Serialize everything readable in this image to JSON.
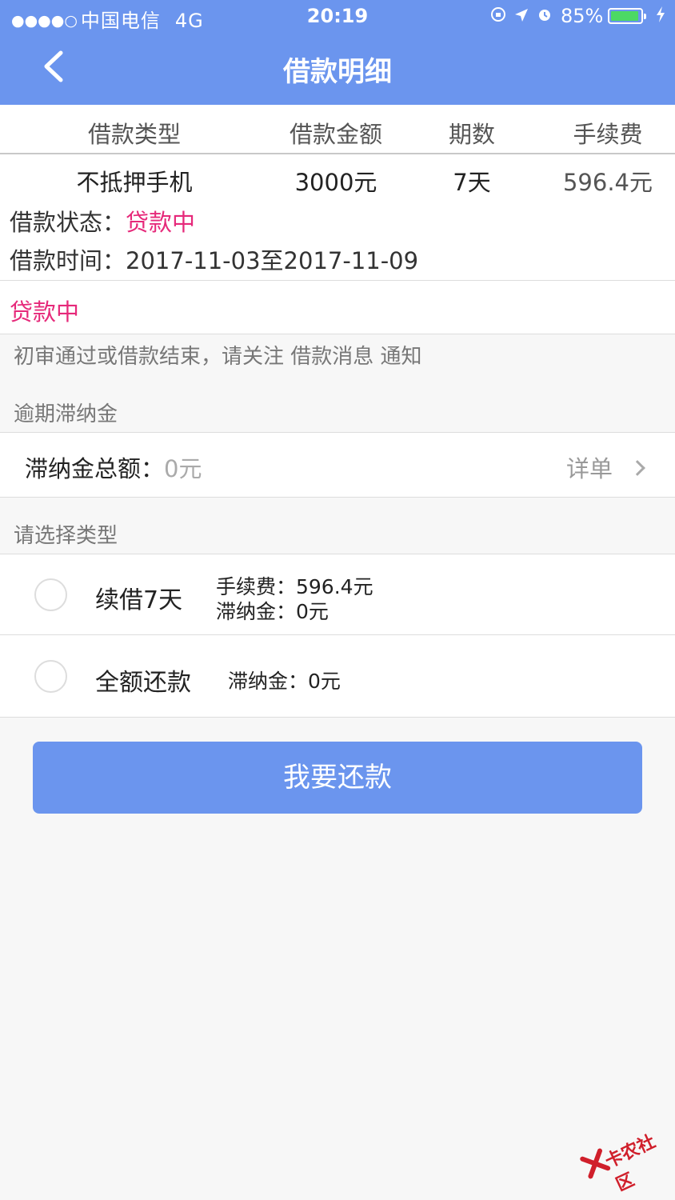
{
  "status_bar": {
    "signal": "●●●●○",
    "carrier": "中国电信",
    "network": "4G",
    "time": "20:19",
    "battery": "85%",
    "icons": [
      "orientation-lock-icon",
      "location-icon",
      "alarm-icon",
      "battery-icon",
      "charging-icon"
    ]
  },
  "nav": {
    "title": "借款明细",
    "back_icon": "back-chevron-icon",
    "bg_color": "#6b95ee"
  },
  "loan_table": {
    "headers": [
      "借款类型",
      "借款金额",
      "期数",
      "手续费"
    ],
    "row": [
      "不抵押手机",
      "3000元",
      "7天",
      "596.4元"
    ]
  },
  "loan_info": {
    "status_label": "借款状态：",
    "status_value": "贷款中",
    "time_label": "借款时间：",
    "time_value": "2017-11-03至2017-11-09"
  },
  "status_block": {
    "text": "贷款中",
    "color": "#e6297a"
  },
  "notice": "初审通过或借款结束，请关注 借款消息 通知",
  "late_fee": {
    "section_title": "逾期滞纳金",
    "label": "滞纳金总额：",
    "value": "0元",
    "detail_label": "详单"
  },
  "type_select": {
    "section_title": "请选择类型",
    "options": [
      {
        "label": "续借7天",
        "detail1": "手续费：596.4元",
        "detail2": "滞纳金：0元"
      },
      {
        "label": "全额还款",
        "detail1": "滞纳金：0元"
      }
    ]
  },
  "pay_button": "我要还款",
  "watermark": "卡农社区"
}
